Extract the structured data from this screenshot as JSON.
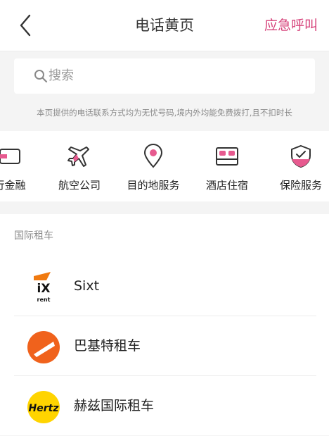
{
  "header": {
    "title": "电话黄页",
    "emergency_label": "应急呼叫"
  },
  "search": {
    "placeholder": "搜索"
  },
  "notice": "本页提供的电话联系方式均为无忧号码,境内外均能免费拨打,且不扣时长",
  "categories": [
    {
      "label": "行金融",
      "icon": "card-icon"
    },
    {
      "label": "航空公司",
      "icon": "airplane-icon"
    },
    {
      "label": "目的地服务",
      "icon": "location-pin-icon"
    },
    {
      "label": "酒店住宿",
      "icon": "bed-icon"
    },
    {
      "label": "保险服务",
      "icon": "shield-check-icon"
    }
  ],
  "section": {
    "title": "国际租车",
    "items": [
      {
        "name": "Sixt",
        "logo": "sixt-logo",
        "logo_text": "rent"
      },
      {
        "name": "巴基特租车",
        "logo": "budget-logo"
      },
      {
        "name": "赫兹国际租车",
        "logo": "hertz-logo",
        "logo_text": "Hertz"
      }
    ]
  },
  "colors": {
    "accent": "#d6427a",
    "icon_fill": "#e75a8f",
    "hertz_yellow": "#ffd400",
    "budget_orange": "#f0621c"
  }
}
